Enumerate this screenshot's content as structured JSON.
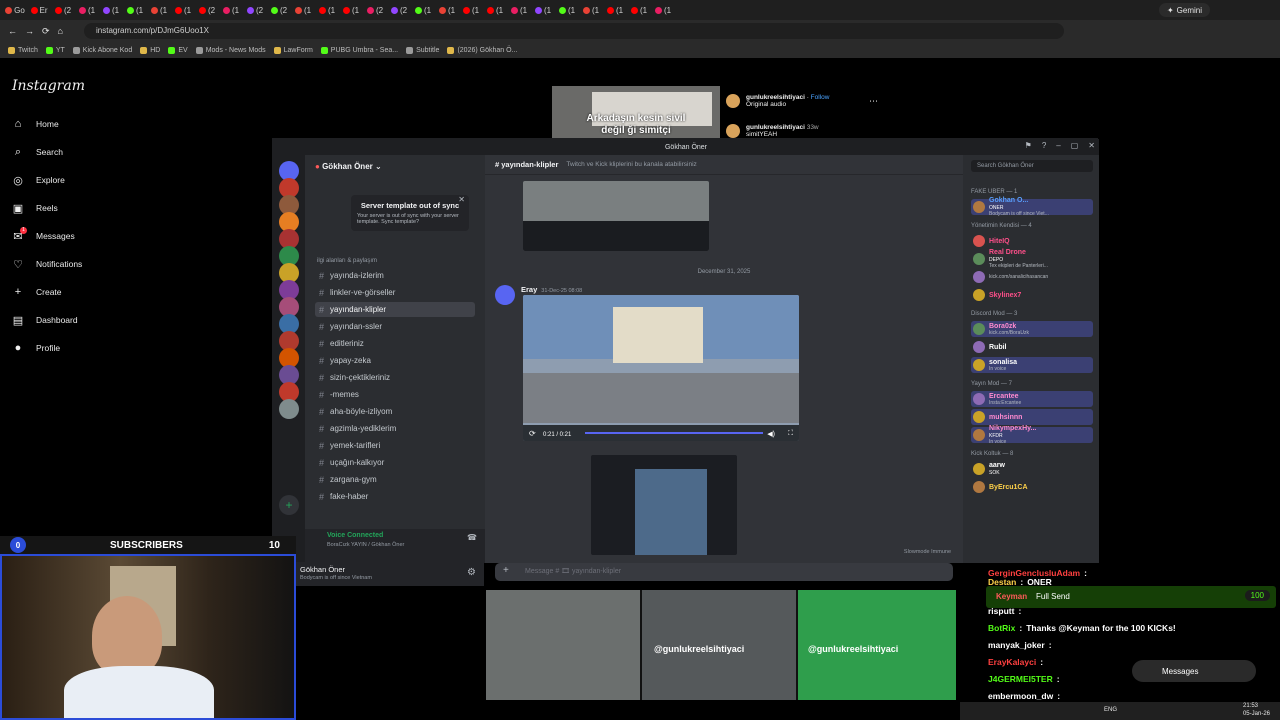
{
  "browser": {
    "tabs": [
      "Go",
      "Er",
      "(2",
      "(1",
      "(1",
      "(1",
      "(1",
      "(1",
      "(2",
      "(1",
      "(2",
      "(2",
      "(1",
      "(1",
      "(1",
      "(2",
      "(2",
      "(1",
      "(1",
      "(1",
      "(1",
      "(1",
      "(1",
      "(1",
      "(1",
      "(1",
      "(1",
      "(1"
    ],
    "gemini_tab": "Gemini",
    "url": "instagram.com/p/DJmG6Uoo1X",
    "bookmarks": [
      "Twitch",
      "YT",
      "Kick Abone Kod",
      "HD",
      "EV",
      "Mods - News Mods",
      "LawForm",
      "PUBG Umbra - Sea...",
      "Subtitle",
      "(2026) Gökhan Ö..."
    ]
  },
  "instagram": {
    "logo": "Instagram",
    "nav": [
      {
        "label": "Home",
        "icon": "home-icon"
      },
      {
        "label": "Search",
        "icon": "search-icon"
      },
      {
        "label": "Explore",
        "icon": "explore-icon"
      },
      {
        "label": "Reels",
        "icon": "reels-icon"
      },
      {
        "label": "Messages",
        "icon": "messages-icon",
        "badge": "1"
      },
      {
        "label": "Notifications",
        "icon": "heart-icon"
      },
      {
        "label": "Create",
        "icon": "plus-icon"
      },
      {
        "label": "Dashboard",
        "icon": "dashboard-icon"
      },
      {
        "label": "Profile",
        "icon": "profile-icon"
      }
    ],
    "post_caption_1": "Arkadaşın kesin sivil",
    "post_caption_2": "değil ği simitçi",
    "post_user": "gunlukreelsihtiyaci",
    "follow_label": "Follow",
    "original_audio": "Original audio",
    "comment_user": "gunlukreelsihtiyaci",
    "comment_time": "33w",
    "comment_text": "simitYEAH",
    "reel_watermark": "@gunlukreelsihtiyaci"
  },
  "discord": {
    "window_title": "Gökhan Öner",
    "guild_name": "Gökhan Öner",
    "template_title": "Server template out of sync",
    "template_sub": "Your server is out of sync with your server template. Sync template?",
    "category": "ilgi alanları & paylaşım",
    "channels": [
      {
        "name": "yayında-izlerim",
        "active": false
      },
      {
        "name": "linkler-ve-görseller",
        "active": false
      },
      {
        "name": "yayından-klipler",
        "active": true
      },
      {
        "name": "yayından-ssler",
        "active": false
      },
      {
        "name": "editleriniz",
        "active": false
      },
      {
        "name": "yapay-zeka",
        "active": false
      },
      {
        "name": "sizin-çektikleriniz",
        "active": false
      },
      {
        "name": "-memes",
        "active": false
      },
      {
        "name": "aha-böyle-izliyom",
        "active": false
      },
      {
        "name": "agzimla-yediklerim",
        "active": false
      },
      {
        "name": "yemek-tarifleri",
        "active": false
      },
      {
        "name": "uçağın-kalkıyor",
        "active": false
      },
      {
        "name": "zargana-gym",
        "active": false
      },
      {
        "name": "fake-haber",
        "active": false
      }
    ],
    "voice_status": "Voice Connected",
    "voice_channel": "BoraCızk YAYIN / Gökhan Öner",
    "user_name": "Gökhan Öner",
    "user_status": "Bodycam is off since Vietnam",
    "chat_channel": "yayından-klipler",
    "chat_topic": "Twitch ve Kick kliplerini bu kanala atabilirsiniz",
    "date_divider": "December 31, 2025",
    "message_author": "Eray",
    "message_time": "31-Dec-25 08:08",
    "video_time": "0:21 / 0:21",
    "slowmode": "Slowmode Immune",
    "composer_placeholder": "Message # 🎞 yayından-klipler",
    "member_search": "Search Gökhan Öner",
    "member_groups": [
      {
        "title": "FAKE UBER — 1",
        "members": [
          {
            "name": "Gokhan O...",
            "tag": "ONER",
            "status": "Bodycam is off since Viet...",
            "color": "#5aa0ff"
          }
        ]
      },
      {
        "title": "Yönetimin Kendisi — 4",
        "members": [
          {
            "name": "HiteIQ",
            "tag": "",
            "status": "",
            "color": "#ff4f8a"
          },
          {
            "name": "Real Drone",
            "tag": "DEPO",
            "status": "Tex ekipleri de Panterleri...",
            "color": "#ff4f8a"
          },
          {
            "name": "",
            "tag": "",
            "status": "kick.com/sanalicihasancan",
            "color": "#ff4f8a"
          },
          {
            "name": "Skylinex7",
            "tag": "",
            "status": "",
            "color": "#ff4f8a"
          }
        ]
      },
      {
        "title": "Discord Mod — 3",
        "members": [
          {
            "name": "Bora0zk",
            "tag": "",
            "status": "kick.com/BoraUzk",
            "color": "#ff8ad0"
          },
          {
            "name": "Rubil",
            "tag": "",
            "status": "",
            "color": "#ffffff"
          },
          {
            "name": "sonalisa",
            "tag": "",
            "status": "In voice",
            "color": "#ffffff"
          }
        ]
      },
      {
        "title": "Yayın Mod — 7",
        "members": [
          {
            "name": "Ercantee",
            "tag": "",
            "status": "Insta:Ercantee",
            "color": "#ff8ad0"
          },
          {
            "name": "muhsinnn",
            "tag": "",
            "status": "",
            "color": "#ff8ad0"
          },
          {
            "name": "NikympexHy...",
            "tag": "KFDR",
            "status": "In voice",
            "color": "#ff8ad0"
          }
        ]
      },
      {
        "title": "Kick Koltuk — 8",
        "members": [
          {
            "name": "aarw",
            "tag": "SOK",
            "status": "",
            "color": "#ffffff"
          },
          {
            "name": "ByErcu1CA",
            "tag": "",
            "status": "",
            "color": "#ffd24a"
          }
        ]
      }
    ]
  },
  "overlay": {
    "subs_count_left": "0",
    "subs_label": "SUBSCRIBERS",
    "subs_goal": "10",
    "tip_user": "Keyman",
    "tip_label": "Full Send",
    "tip_amount": "100",
    "chat": [
      {
        "user": "GerginGenclusluAdam",
        "text": "",
        "color": "#ff4040"
      },
      {
        "user": "Destan",
        "text": "ONER",
        "color": "#ffd24a"
      },
      {
        "user": "risputt",
        "text": "",
        "color": "#ffffff"
      },
      {
        "user": "BotRix",
        "text": "Thanks @Keyman for the 100 KICKs!",
        "color": "#53fc18"
      },
      {
        "user": "manyak_joker",
        "text": "",
        "color": "#ffffff"
      },
      {
        "user": "ErayKalayci",
        "text": "",
        "color": "#ff4040"
      },
      {
        "user": "J4GERMEI5TER",
        "text": "",
        "color": "#53fc18"
      },
      {
        "user": "embermoon_dw",
        "text": "",
        "color": "#ffffff"
      }
    ],
    "messages_popup": "Messages"
  },
  "taskbar": {
    "lang": "ENG",
    "time": "21:53",
    "date": "05-Jan-26"
  },
  "colors": {
    "discord_bg": "#313338",
    "discord_side": "#2b2d31",
    "discord_rail": "#1e1f22",
    "kick_green": "#53fc18",
    "ig_bg": "#000000"
  }
}
